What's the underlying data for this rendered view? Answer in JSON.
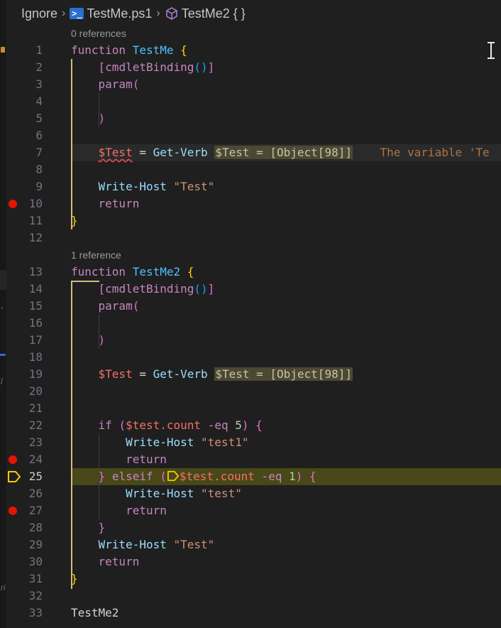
{
  "breadcrumb": {
    "folder": "Ignore",
    "file": "TestMe.ps1",
    "symbol": "TestMe2 { }"
  },
  "codelens": {
    "testme": "0 references",
    "testme2": "1 reference"
  },
  "lines": [
    {
      "n": "1"
    },
    {
      "n": "2"
    },
    {
      "n": "3"
    },
    {
      "n": "4"
    },
    {
      "n": "5"
    },
    {
      "n": "6"
    },
    {
      "n": "7"
    },
    {
      "n": "8"
    },
    {
      "n": "9"
    },
    {
      "n": "10"
    },
    {
      "n": "11"
    },
    {
      "n": "12"
    },
    {
      "n": "13"
    },
    {
      "n": "14"
    },
    {
      "n": "15"
    },
    {
      "n": "16"
    },
    {
      "n": "17"
    },
    {
      "n": "18"
    },
    {
      "n": "19"
    },
    {
      "n": "20"
    },
    {
      "n": "21"
    },
    {
      "n": "22"
    },
    {
      "n": "23"
    },
    {
      "n": "24"
    },
    {
      "n": "25"
    },
    {
      "n": "26"
    },
    {
      "n": "27"
    },
    {
      "n": "28"
    },
    {
      "n": "29"
    },
    {
      "n": "30"
    },
    {
      "n": "31"
    },
    {
      "n": "32"
    },
    {
      "n": "33"
    }
  ],
  "code": {
    "kw_function": "function",
    "name_testme": "TestMe",
    "name_testme2": "TestMe2",
    "open_brace": "{",
    "close_brace": "}",
    "cmdletbinding": "cmdletBinding",
    "param": "param",
    "var_test": "$Test",
    "assign": " = ",
    "get_verb": "Get-Verb",
    "inlay_hint": "$Test = [Object[98]]",
    "inline_error": "The variable 'Te",
    "write_host": "Write-Host",
    "str_test": "\"Test\"",
    "str_test1": "\"test1\"",
    "str_test_lower": "\"test\"",
    "kw_return": "return",
    "kw_if": "if",
    "kw_elseif": "elseif",
    "var_test_lower": "$test",
    "prop_count": ".count",
    "op_eq": "-eq",
    "num5": "5",
    "num1": "1",
    "call_testme2": "TestMe2"
  },
  "colors": {
    "background": "#1f1f1f",
    "breakpoint": "#e51400",
    "current_line": "#4b4b18",
    "bracket_guide": "#d7ba7d"
  },
  "debug": {
    "breakpoint_lines": [
      "10",
      "24",
      "27"
    ],
    "current_line": "25"
  }
}
